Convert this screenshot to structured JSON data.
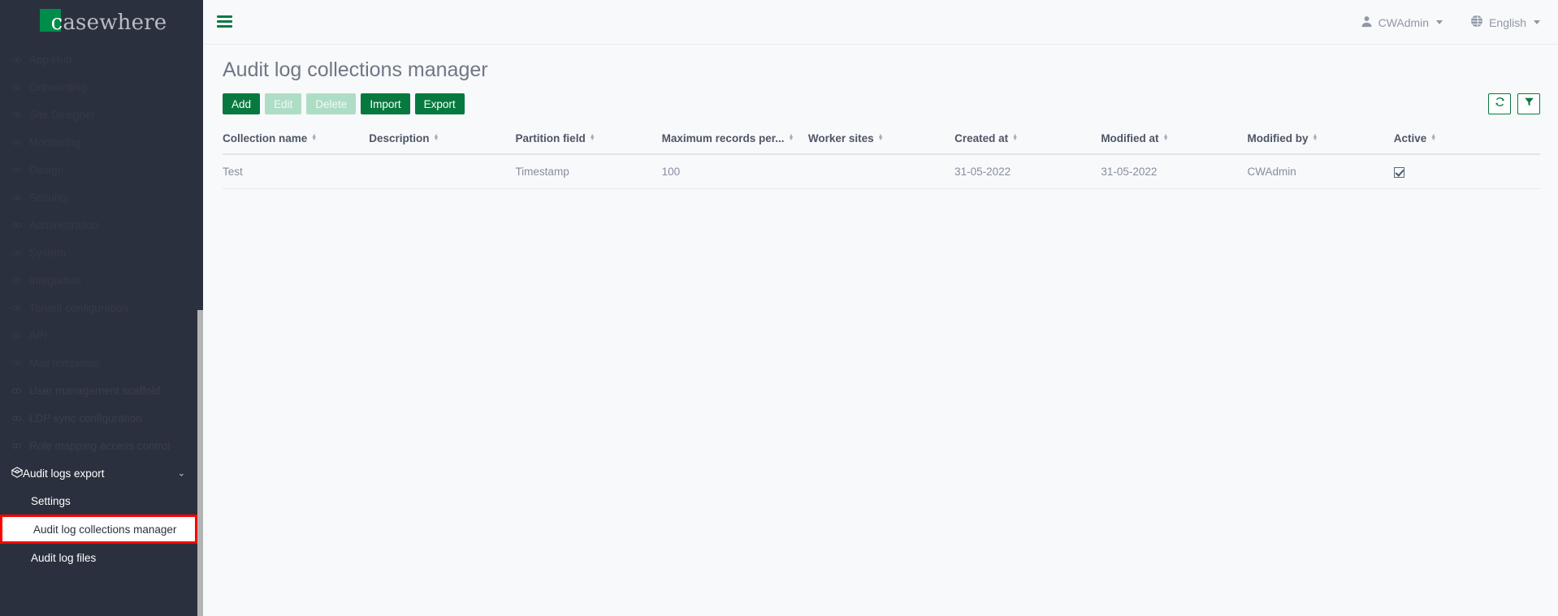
{
  "brand": {
    "logo_first_letter": "c",
    "logo_rest": "asewhere",
    "logo_square_color": "#008d4c"
  },
  "topbar": {
    "hamburger_icon": "hamburger-icon",
    "user_icon": "user-icon",
    "user_label": "CWAdmin",
    "language_icon": "globe-icon",
    "language_label": "English"
  },
  "sidebar": {
    "faded_items": [
      {
        "label": "App Hub",
        "icon": "grid-icon"
      },
      {
        "label": "Onboarding",
        "icon": "link-icon"
      },
      {
        "label": "Site Designer",
        "icon": "link-icon"
      },
      {
        "label": "Monitoring",
        "icon": "gear-icon"
      },
      {
        "label": "Design",
        "icon": "pen-icon"
      },
      {
        "label": "Security",
        "icon": "shield-icon"
      },
      {
        "label": "Administration",
        "icon": "tools-icon"
      },
      {
        "label": "System",
        "icon": "cog-icon"
      },
      {
        "label": "Integration",
        "icon": "plug-icon"
      },
      {
        "label": "Tenant configuration",
        "icon": "sliders-icon"
      },
      {
        "label": "API",
        "icon": "code-icon"
      },
      {
        "label": "Mail templates",
        "icon": "mail-icon"
      }
    ],
    "faded_items2": [
      {
        "label": "User management scaffold",
        "icon": "users-icon"
      },
      {
        "label": "LDP sync configuration",
        "icon": "sync-icon"
      },
      {
        "label": "Role mapping access control",
        "icon": "key-icon"
      }
    ],
    "group": {
      "label": "Audit logs export",
      "icon": "cube-icon",
      "chevron_icon": "chevron-down-icon",
      "chevron_glyph": "⌄"
    },
    "sub_items": [
      {
        "label": "Settings",
        "selected": false
      },
      {
        "label": "Audit log collections manager",
        "selected": true
      },
      {
        "label": "Audit log files",
        "selected": false
      }
    ],
    "selection_outline_color": "#ff0000"
  },
  "page": {
    "title": "Audit log collections manager"
  },
  "toolbar": {
    "buttons": [
      {
        "label": "Add",
        "disabled": false
      },
      {
        "label": "Edit",
        "disabled": true
      },
      {
        "label": "Delete",
        "disabled": true
      },
      {
        "label": "Import",
        "disabled": false
      },
      {
        "label": "Export",
        "disabled": false
      }
    ],
    "refresh_icon": "refresh-icon",
    "filter_icon": "filter-icon",
    "accent_color": "#07793f",
    "disabled_color": "#aeddc6"
  },
  "table": {
    "columns": [
      {
        "label": "Collection name",
        "width": "9.5%"
      },
      {
        "label": "Description",
        "width": "9.5%"
      },
      {
        "label": "Partition field",
        "width": "9.5%"
      },
      {
        "label": "Maximum records per...",
        "width": "9.5%"
      },
      {
        "label": "Worker sites",
        "width": "9.5%"
      },
      {
        "label": "Created at",
        "width": "9.5%"
      },
      {
        "label": "Modified at",
        "width": "9.5%"
      },
      {
        "label": "Modified by",
        "width": "9.5%"
      },
      {
        "label": "Active",
        "width": "9.5%"
      }
    ],
    "sort_up_glyph": "▲",
    "sort_down_glyph": "▼",
    "rows": [
      {
        "collection_name": "Test",
        "description": "",
        "partition_field": "Timestamp",
        "maximum_records_per": "100",
        "worker_sites": "",
        "created_at": "31-05-2022",
        "modified_at": "31-05-2022",
        "modified_by": "CWAdmin",
        "active": true
      }
    ]
  }
}
